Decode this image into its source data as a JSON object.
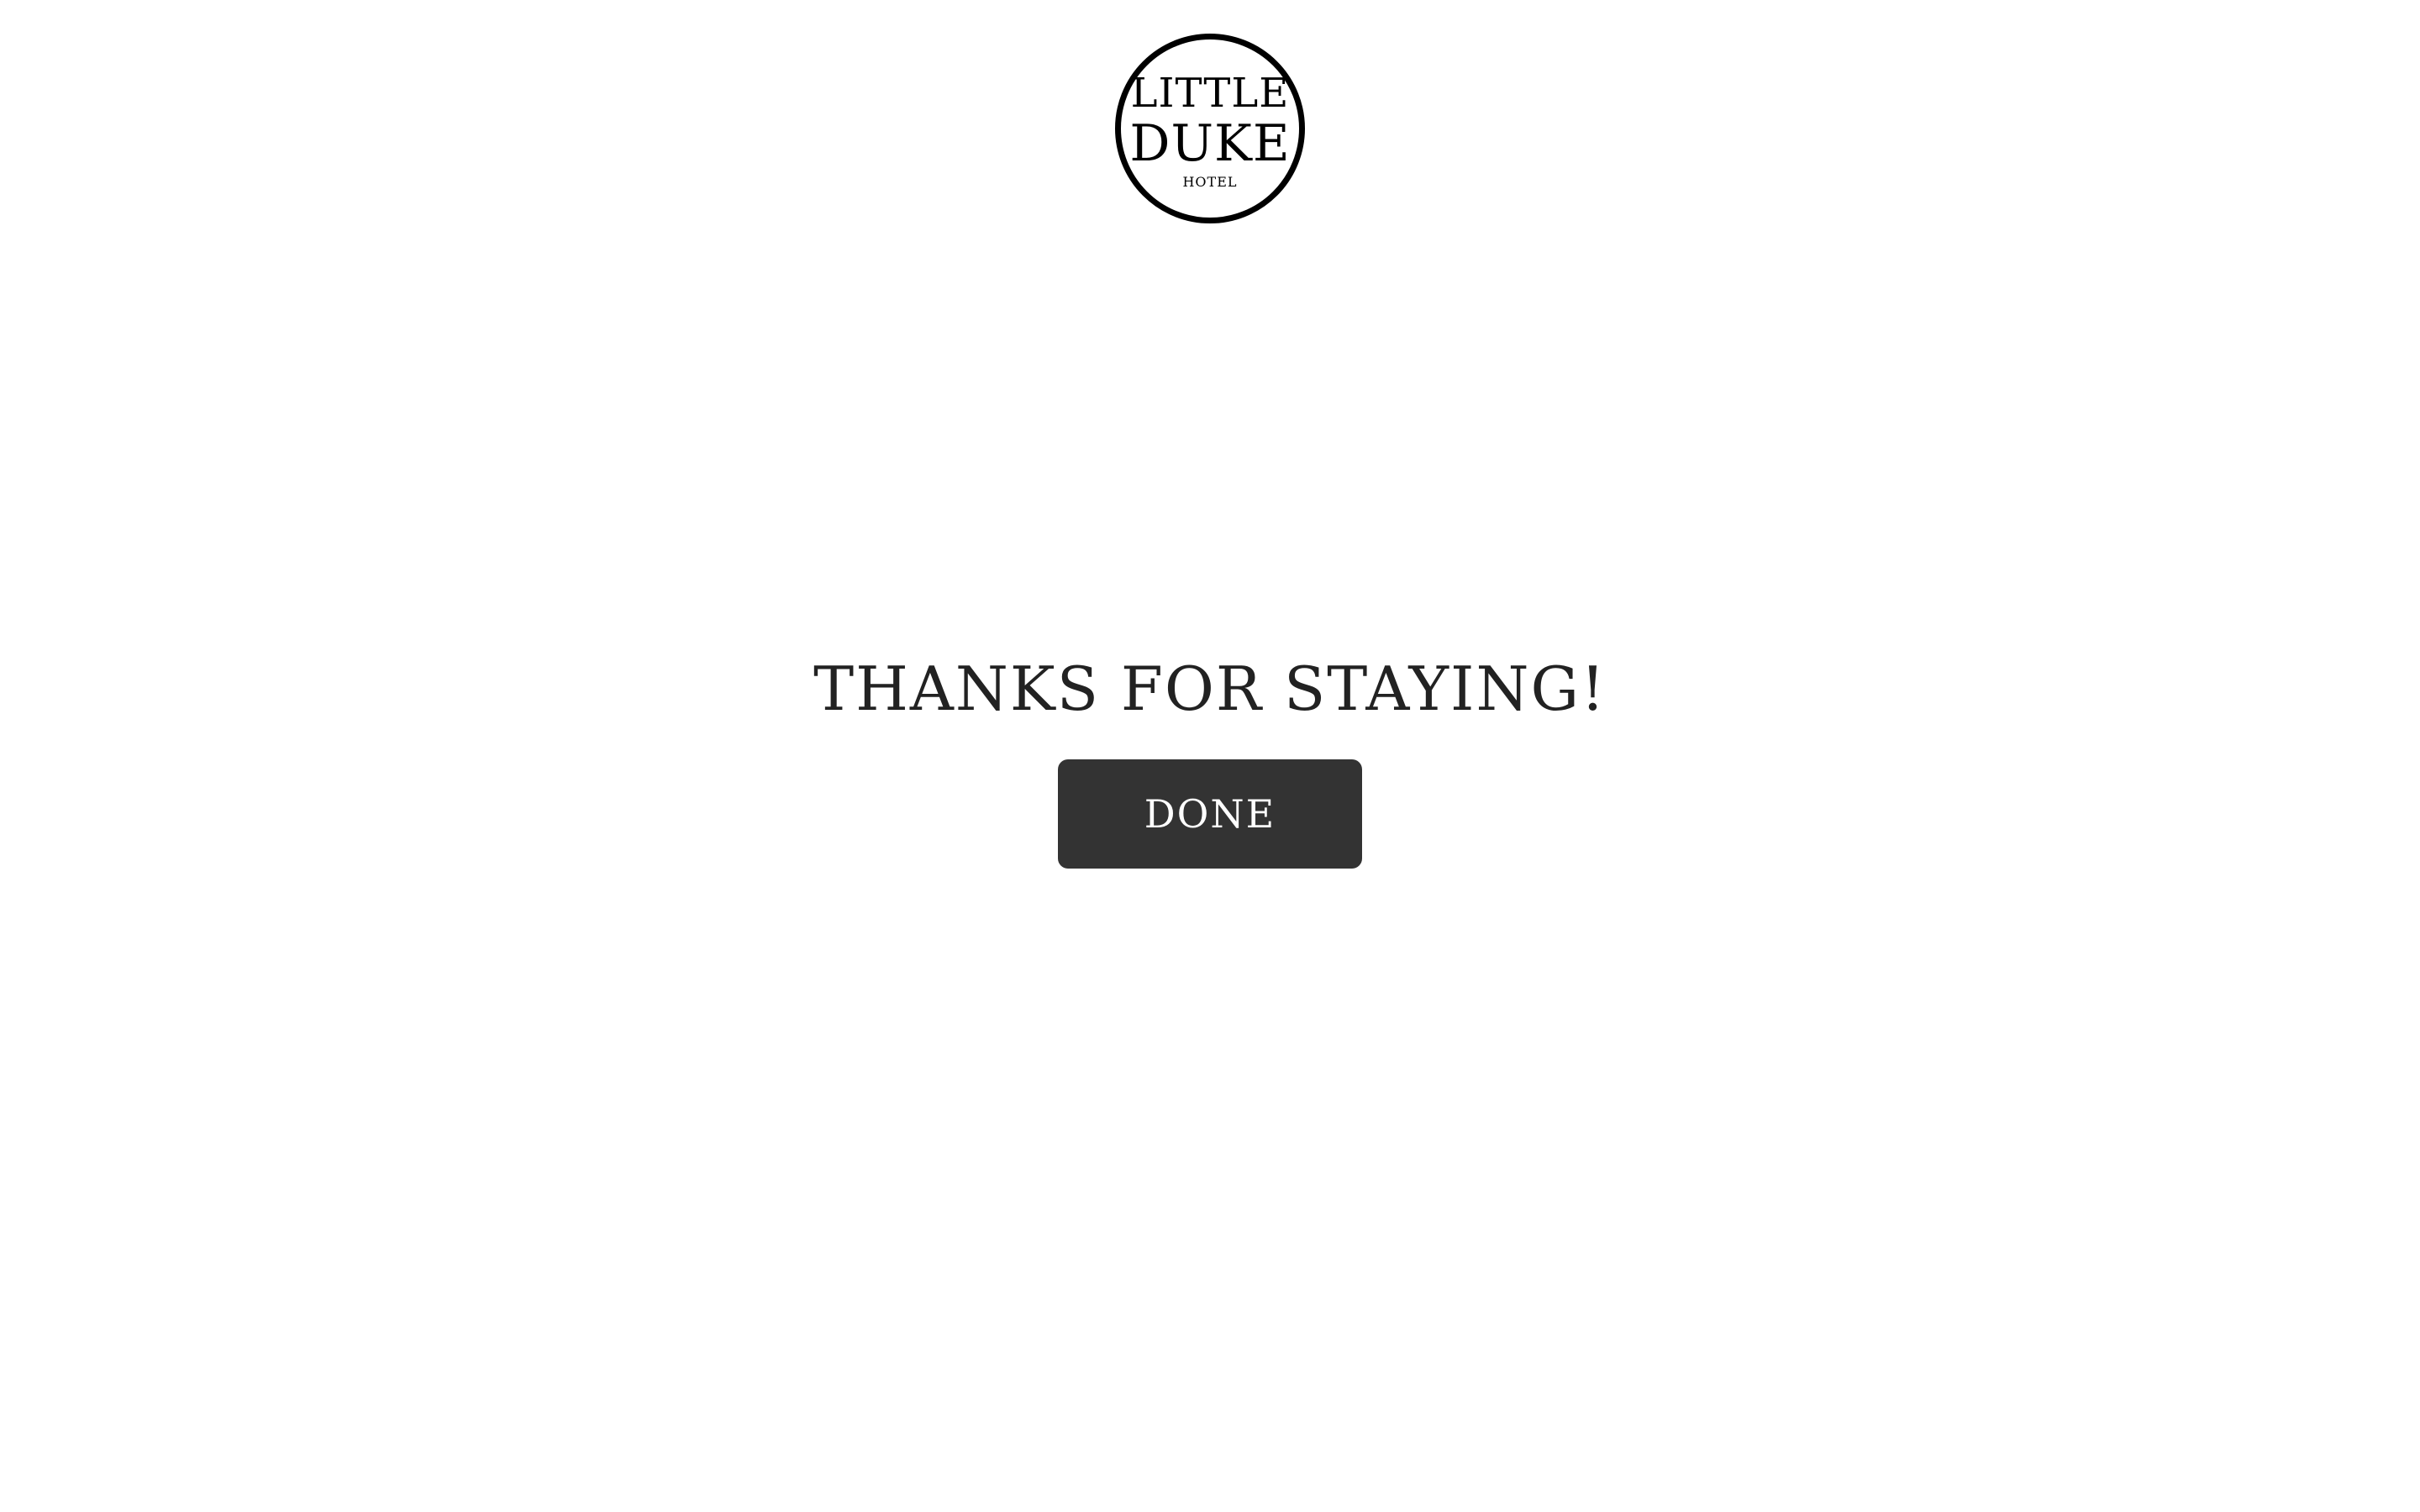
{
  "logo": {
    "line1": "LITTLE",
    "line2": "DUKE",
    "line3": "HOTEL"
  },
  "main": {
    "headline": "THANKS FOR STAYING!",
    "done_label": "DONE"
  },
  "colors": {
    "background": "#ffffff",
    "text": "#222222",
    "button": "#333333",
    "button_text": "#ffffff",
    "logo": "#000000"
  }
}
